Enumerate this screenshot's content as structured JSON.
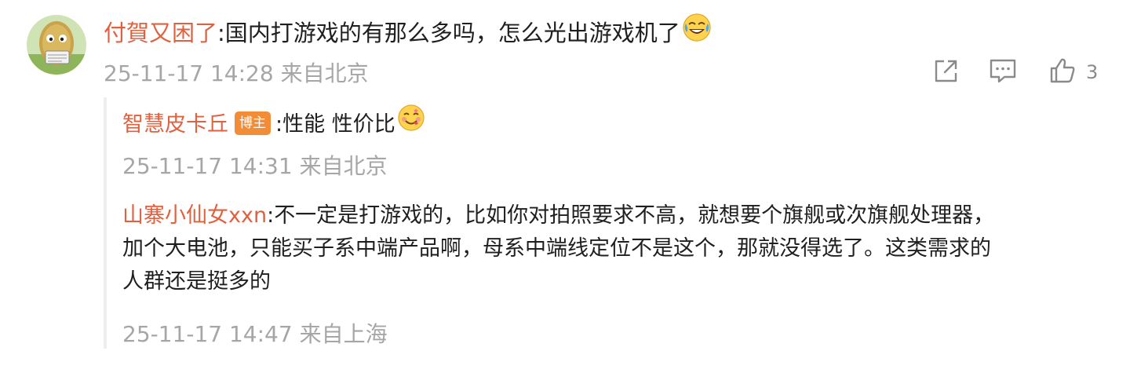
{
  "comment": {
    "author": "付賀又困了",
    "separator": ":",
    "text": "国内打游戏的有那么多吗，怎么光出游戏机了",
    "emoji": "crying-laughing-emoji",
    "timestamp": "25-11-17 14:28",
    "location": "来自北京",
    "like_count": "3"
  },
  "replies": [
    {
      "author": "智慧皮卡丘",
      "badge": "博主",
      "separator": ":",
      "text": "性能 性价比",
      "emoji": "savoring-food-emoji",
      "timestamp": "25-11-17 14:31",
      "location": "来自北京"
    },
    {
      "author": "山寨小仙女xxn",
      "separator": ":",
      "lines": [
        "不一定是打游戏的，比如你对拍照要求不高，就想要个旗舰或次旗舰处理器，",
        "加个大电池，只能买子系中端产品啊，母系中端线定位不是这个，那就没得选了。这类需求的",
        "人群还是挺多的"
      ],
      "timestamp": "25-11-17 14:47",
      "location": "来自上海"
    }
  ],
  "icons": {
    "share": "share-icon",
    "reply": "comment-icon",
    "like": "thumbs-up-icon"
  },
  "colors": {
    "username": "#e0613f",
    "meta": "#a6a6a6",
    "badge": "#f28c36",
    "thread_line": "#eeeeee"
  }
}
